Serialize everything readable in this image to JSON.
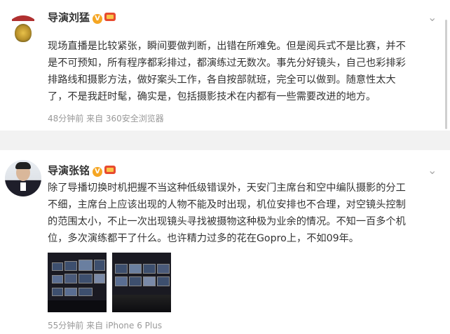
{
  "posts": [
    {
      "name": "导演刘猛",
      "verified": "V",
      "text_lines": [
        "现场直播是比较紧张，瞬间要做判断，出错在所难免。但是阅兵式不是比赛，并不",
        "是不可预知，所有程序都彩排过，都演练过无数次。事先分好镜头，自己也彩排彩",
        "排路线和摄影方法，做好案头工作，各自按部就班，完全可以做到。随意性太大",
        "了，不是我赶时髦，确实是，包括摄影技术在内都有一些需要改进的地方。"
      ],
      "meta": "48分钟前 来自 360安全浏览器"
    },
    {
      "name": "导演张铭",
      "verified": "V",
      "text_lines": [
        "除了导播切换时机把握不当这种低级错误外，天安门主席台和空中编队摄影的分工",
        "不细，主席台上应该出现的人物不能及时出现，机位安排也不合理，对空镜头控制",
        "的范围太小，不止一次出现镜头寻找被摄物这种极为业余的情况。不知一百多个机",
        "位，多次演练都干了什么。也许精力过多的花在Gopro上，不如09年。"
      ],
      "meta": "55分钟前 来自 iPhone 6 Plus"
    }
  ],
  "colors": {
    "verified": "#f5a623",
    "meta": "#999999",
    "text": "#333333"
  }
}
